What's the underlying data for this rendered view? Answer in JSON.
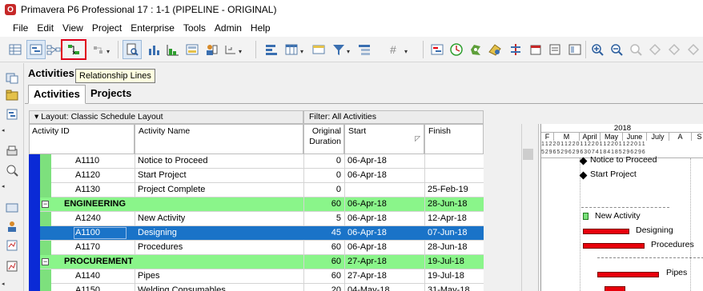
{
  "window": {
    "title": "Primavera P6 Professional 17 : 1-1 (PIPELINE - ORIGINAL)"
  },
  "menu": [
    "File",
    "Edit",
    "View",
    "Project",
    "Enterprise",
    "Tools",
    "Admin",
    "Help"
  ],
  "toolbar": {
    "tooltip": "Relationship Lines",
    "highlight_color": "#e0001b",
    "icons": [
      "table-icon",
      "gantt-icon",
      "network-icon",
      "relationship-lines-icon",
      "schedule-dropdown-icon",
      "print-preview-icon",
      "bar-chart-icon",
      "histogram-icon",
      "details-icon",
      "assign-icon",
      "more-dropdown-icon",
      "bars-icon",
      "columns-icon",
      "timescale-icon",
      "filter-icon",
      "group-icon",
      "sort-icon",
      "schedule-icon",
      "level-icon",
      "apply-actuals-icon",
      "progress-spotlight-icon",
      "store-period-icon",
      "zoom-in-icon",
      "zoom-out-icon",
      "zoom-fit-icon",
      "expand-all-icon",
      "collapse-all-icon"
    ]
  },
  "panel": {
    "title": "Activities",
    "tabs": [
      "Activities",
      "Projects"
    ],
    "layout_label": "Layout: Classic Schedule Layout",
    "filter_label": "Filter: All Activities"
  },
  "columns": {
    "activity_id": "Activity ID",
    "activity_name": "Activity Name",
    "original_duration": "Original\nDuration",
    "start": "Start",
    "finish": "Finish"
  },
  "rows": [
    {
      "type": "activity",
      "id": "A1110",
      "name": "Notice to Proceed",
      "duration": "0",
      "start": "06-Apr-18",
      "finish": ""
    },
    {
      "type": "activity",
      "id": "A1120",
      "name": "Start Project",
      "duration": "0",
      "start": "06-Apr-18",
      "finish": ""
    },
    {
      "type": "activity",
      "id": "A1130",
      "name": "Project Complete",
      "duration": "0",
      "start": "",
      "finish": "25-Feb-19"
    },
    {
      "type": "wbs",
      "id": "",
      "name": "ENGINEERING",
      "duration": "60",
      "start": "06-Apr-18",
      "finish": "28-Jun-18"
    },
    {
      "type": "activity",
      "id": "A1240",
      "name": "New Activity",
      "duration": "5",
      "start": "06-Apr-18",
      "finish": "12-Apr-18"
    },
    {
      "type": "selected",
      "id": "A1100",
      "name": "Designing",
      "duration": "45",
      "start": "06-Apr-18",
      "finish": "07-Jun-18"
    },
    {
      "type": "activity",
      "id": "A1170",
      "name": "Procedures",
      "duration": "60",
      "start": "06-Apr-18",
      "finish": "28-Jun-18"
    },
    {
      "type": "wbs",
      "id": "",
      "name": "PROCUREMENT",
      "duration": "60",
      "start": "27-Apr-18",
      "finish": "19-Jul-18"
    },
    {
      "type": "activity",
      "id": "A1140",
      "name": "Pipes",
      "duration": "60",
      "start": "27-Apr-18",
      "finish": "19-Jul-18"
    },
    {
      "type": "activity",
      "id": "A1150",
      "name": "Welding Consumables",
      "duration": "20",
      "start": "04-May-18",
      "finish": "31-May-18"
    }
  ],
  "gantt": {
    "year": "2018",
    "months": [
      "F",
      "M",
      "April",
      "May",
      "June",
      "July",
      "A",
      "S"
    ],
    "weeks_row1": "1 1 2 2 0 1 1 2 2 0 1 1 2 2 0 1 1 2 2 0 1 1 2 2 0 1 1",
    "weeks_row2": "5 2 9 6 5 2 9 6 2 9 6 3 0 7 4 1 8 4 1 8 5 2 9 6 2 9 6",
    "labels": [
      "Notice to Proceed",
      "Start Project",
      "New Activity",
      "Designing",
      "Procedures",
      "Pipes"
    ],
    "bar_color": "#e8000b",
    "wbs_color": "#8af58a",
    "selected_color": "#1a73c8"
  }
}
